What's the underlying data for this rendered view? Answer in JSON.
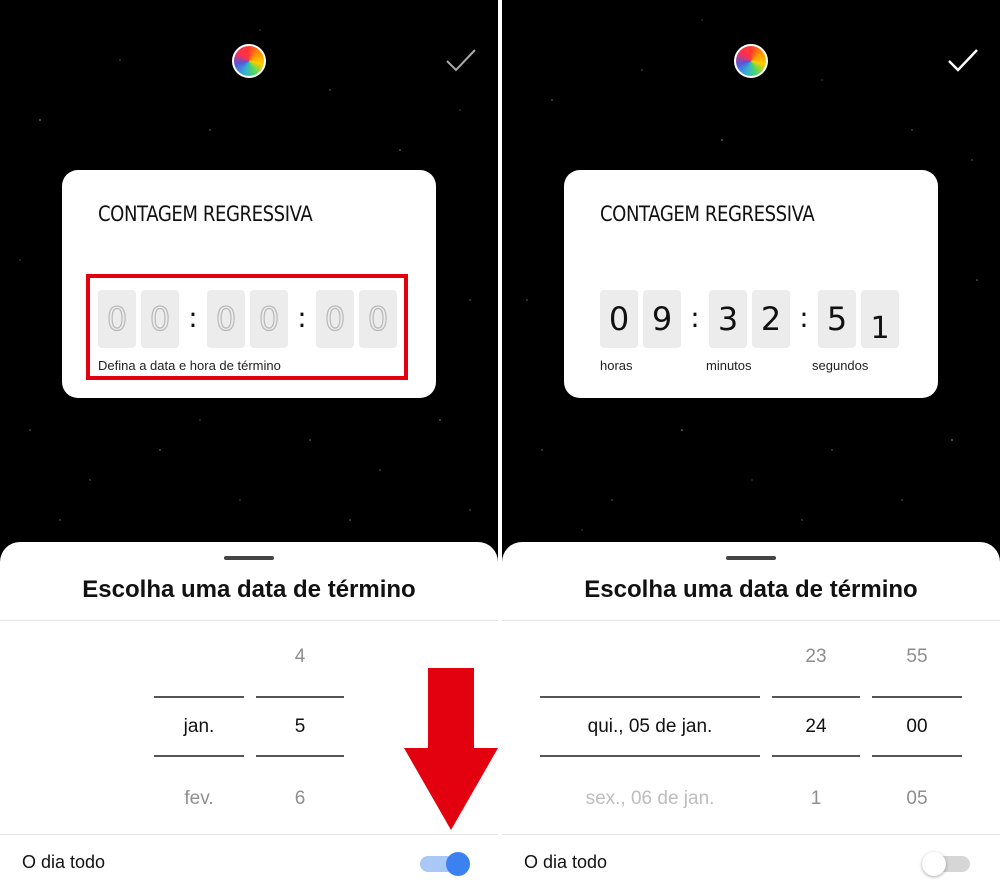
{
  "left": {
    "card_title": "CONTAGEM REGRESSIVA",
    "digits": [
      "0",
      "0",
      "0",
      "0",
      "0",
      "0"
    ],
    "hint": "Defina a data e hora de término",
    "sheet_title": "Escolha uma data de término",
    "wheel_month": {
      "selected": "jan.",
      "next": "fev."
    },
    "wheel_day": {
      "prev": "4",
      "selected": "5",
      "next": "6"
    },
    "all_day_label": "O dia todo",
    "all_day_on": true
  },
  "right": {
    "card_title": "CONTAGEM REGRESSIVA",
    "digits": [
      "0",
      "9",
      "3",
      "2",
      "5",
      "1"
    ],
    "units": {
      "hours": "horas",
      "minutes": "minutos",
      "seconds": "segundos"
    },
    "sheet_title": "Escolha uma data de término",
    "wheel_date": {
      "selected": "qui., 05 de jan.",
      "next": "sex., 06 de jan."
    },
    "wheel_hour": {
      "prev": "23",
      "selected": "24",
      "next": "1"
    },
    "wheel_minute": {
      "prev": "55",
      "selected": "00",
      "next": "05"
    },
    "all_day_label": "O dia todo",
    "all_day_on": false
  },
  "colors": {
    "background": "#000000",
    "highlight": "#e3000f",
    "toggle_on": "#3b82f0",
    "arrow": "#e3000f"
  },
  "icons": [
    "color-wheel-icon",
    "checkmark-icon",
    "arrow-down-icon"
  ]
}
